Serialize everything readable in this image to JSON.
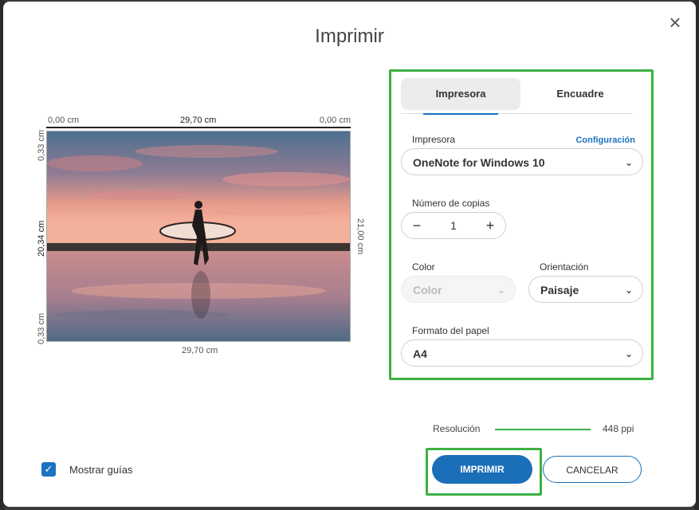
{
  "dialog": {
    "title": "Imprimir",
    "close_icon": "×"
  },
  "preview": {
    "top_left": "0,00 cm",
    "top_center": "29,70 cm",
    "top_right": "0,00 cm",
    "left_top": "0,33 cm",
    "left_center": "20,34 cm",
    "left_bottom": "0,33 cm",
    "right_center": "21,00 cm",
    "bottom_center": "29,70 cm"
  },
  "tabs": [
    {
      "label": "Impresora",
      "active": true
    },
    {
      "label": "Encuadre",
      "active": false
    }
  ],
  "printer": {
    "label": "Impresora",
    "config_link": "Configuración",
    "value": "OneNote for Windows 10"
  },
  "copies": {
    "label": "Número de copias",
    "minus": "−",
    "value": "1",
    "plus": "+"
  },
  "color": {
    "label": "Color",
    "value": "Color",
    "disabled": true
  },
  "orientation": {
    "label": "Orientación",
    "value": "Paisaje"
  },
  "paper": {
    "label": "Formato del papel",
    "value": "A4"
  },
  "resolution": {
    "label": "Resolución",
    "value": "448 ppi"
  },
  "footer": {
    "show_guides_label": "Mostrar guías",
    "show_guides_checked": true,
    "print_label": "IMPRIMIR",
    "cancel_label": "CANCELAR"
  },
  "colors": {
    "accent": "#1a6fb8",
    "highlight": "#3cb043"
  }
}
